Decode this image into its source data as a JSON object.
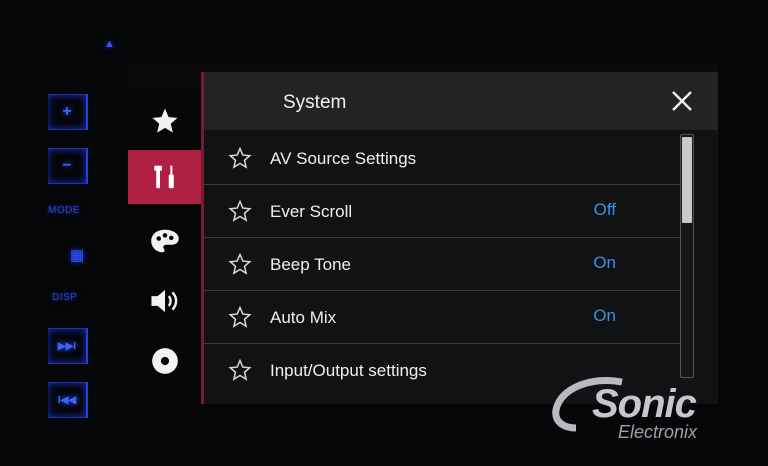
{
  "hardware": {
    "plus_label": "+",
    "minus_label": "−",
    "mode_label": "MODE",
    "disp_label": "DISP",
    "next_label": "▶▶I",
    "prev_label": "I◀◀"
  },
  "sidebar": {
    "items": [
      {
        "icon": "star-icon",
        "active": false
      },
      {
        "icon": "tools-icon",
        "active": true
      },
      {
        "icon": "palette-icon",
        "active": false
      },
      {
        "icon": "speaker-icon",
        "active": false
      },
      {
        "icon": "disc-icon",
        "active": false
      }
    ]
  },
  "panel": {
    "title": "System",
    "rows": [
      {
        "label": "AV Source Settings",
        "value": ""
      },
      {
        "label": "Ever Scroll",
        "value": "Off"
      },
      {
        "label": "Beep Tone",
        "value": "On"
      },
      {
        "label": "Auto Mix",
        "value": "On"
      },
      {
        "label": "Input/Output settings",
        "value": ""
      }
    ]
  },
  "watermark": {
    "brand": "Sonic",
    "sub": "Electronix"
  },
  "colors": {
    "accent": "#b02042",
    "value_text": "#3d8fe8",
    "hardware_led": "#2f57ff"
  }
}
